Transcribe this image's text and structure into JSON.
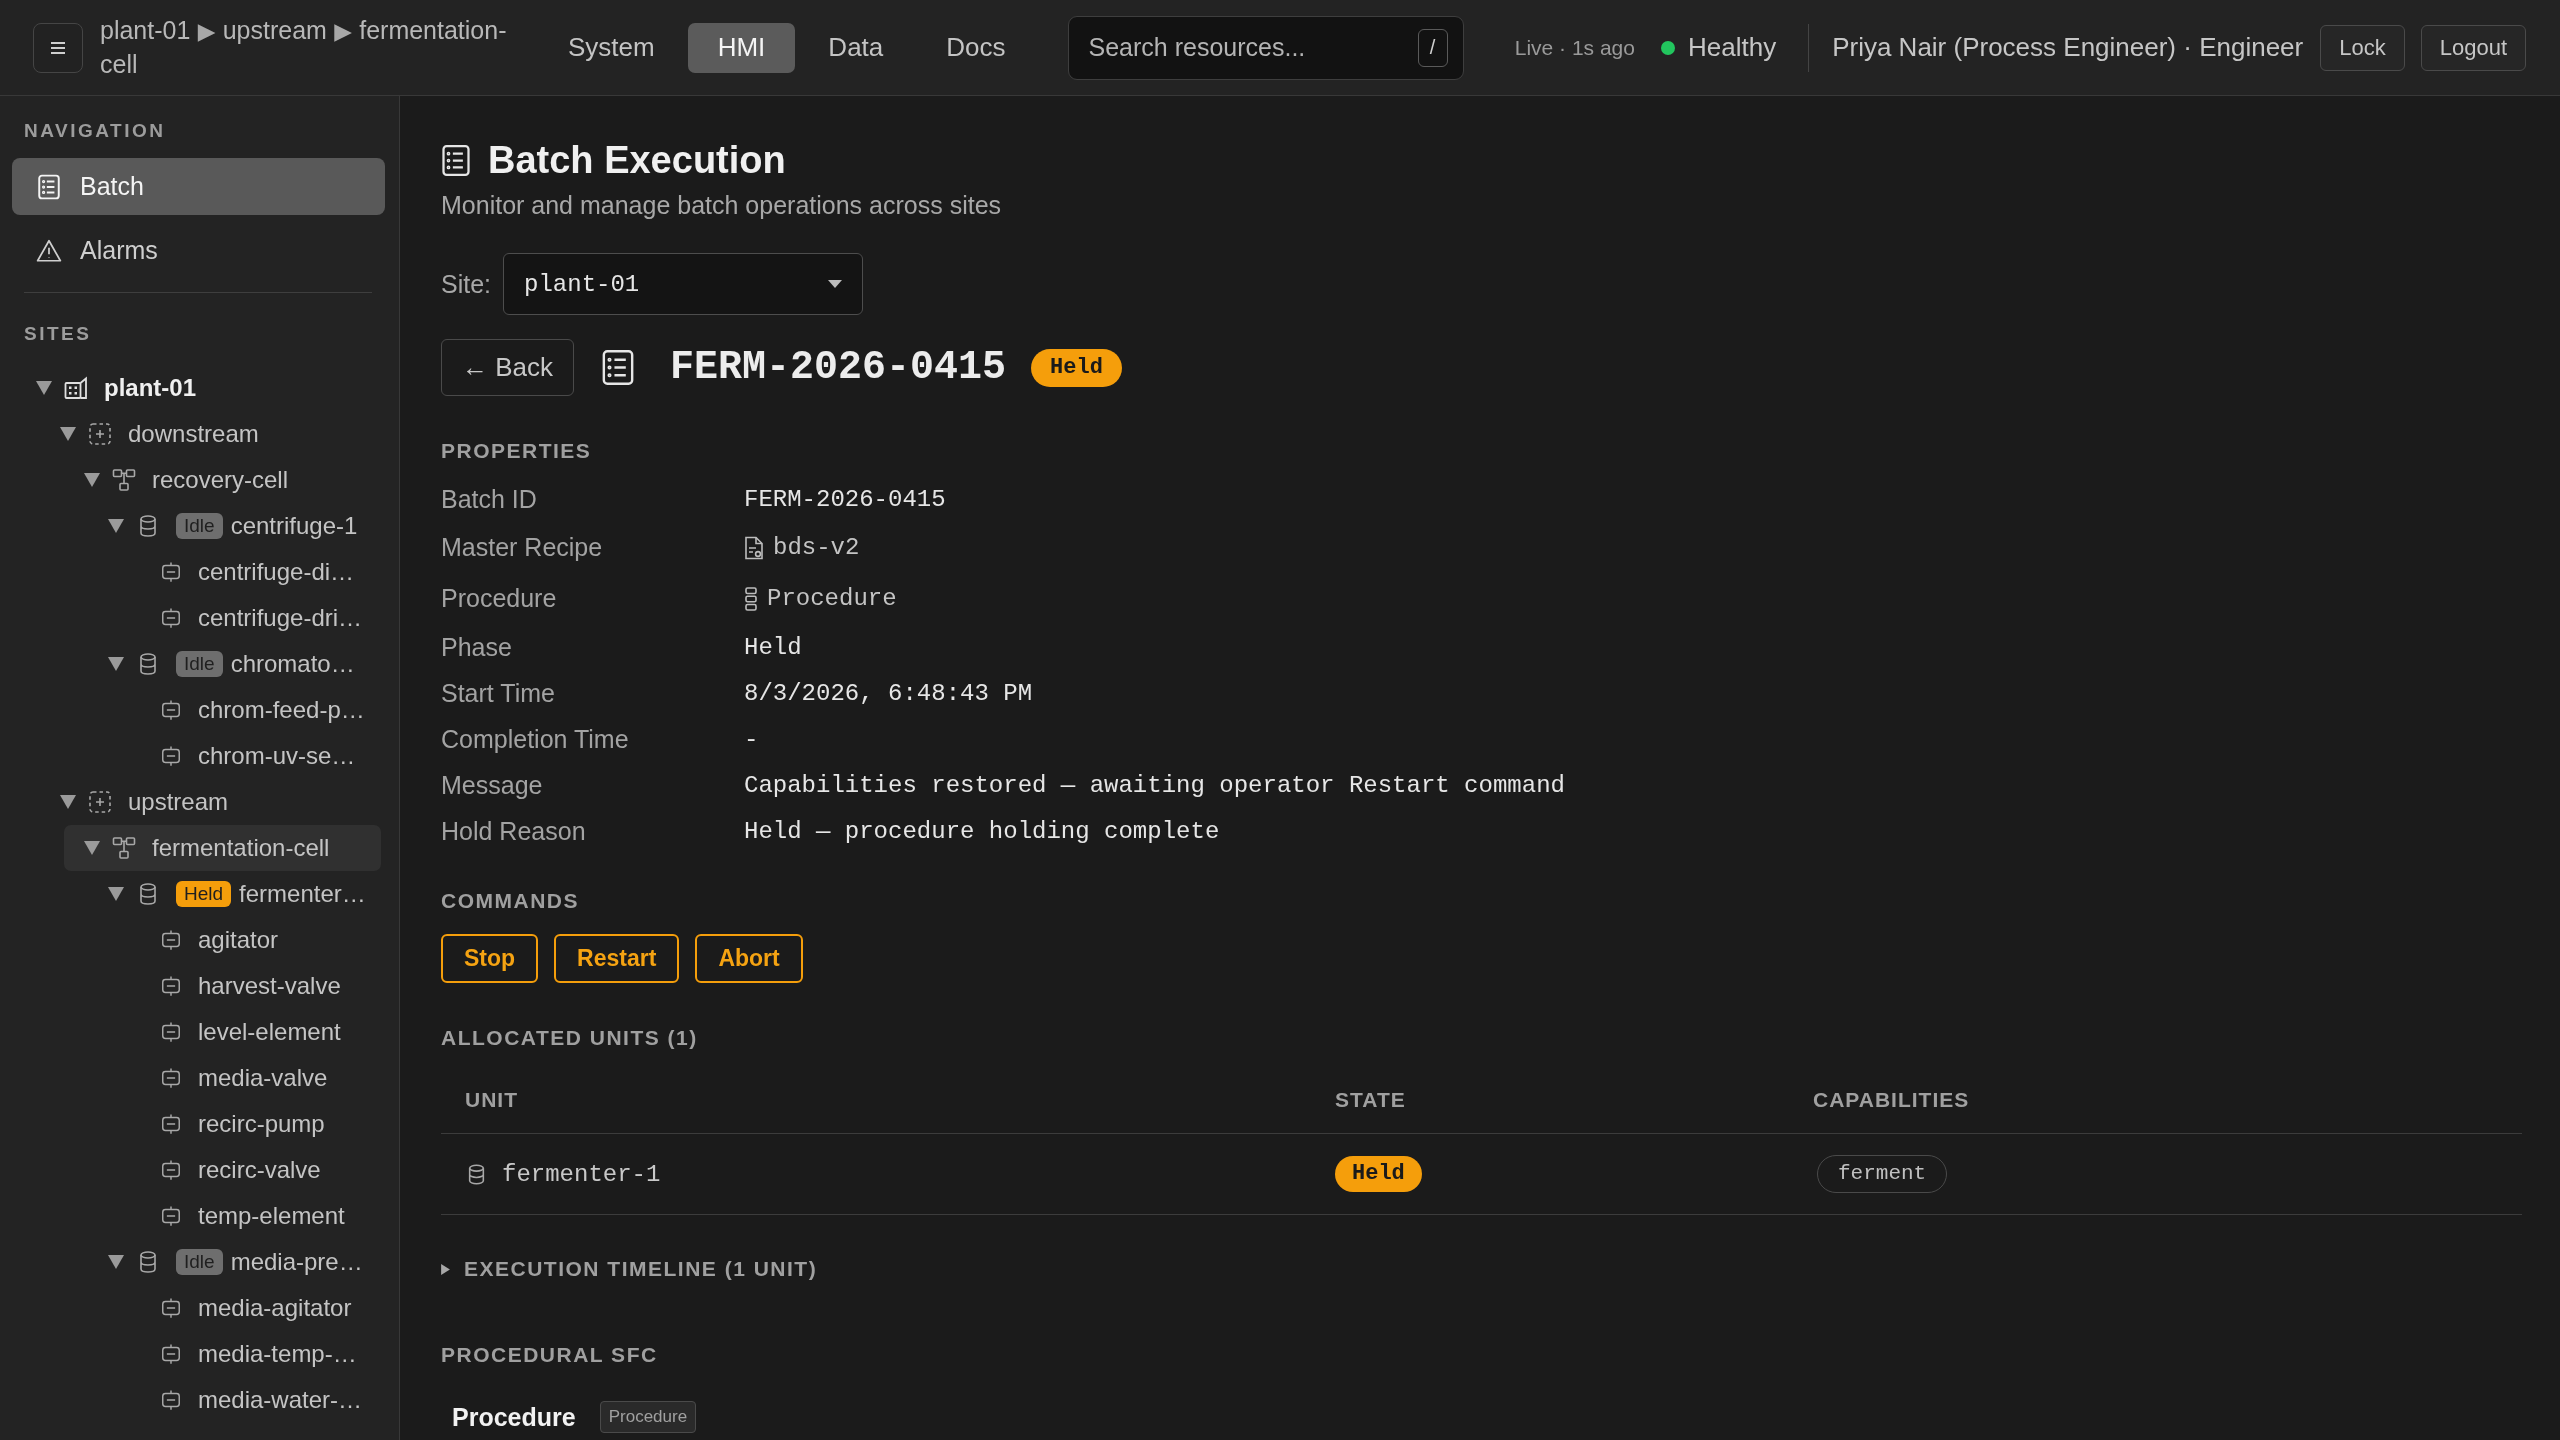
{
  "topbar": {
    "breadcrumb": {
      "items": [
        "plant-01",
        "upstream",
        "fermentation-cell"
      ],
      "separator": "▶"
    },
    "tabs": [
      {
        "label": "System",
        "selected": false
      },
      {
        "label": "HMI",
        "selected": true
      },
      {
        "label": "Data",
        "selected": false
      },
      {
        "label": "Docs",
        "selected": false
      }
    ],
    "search": {
      "placeholder": "Search resources...",
      "shortcut": "/"
    },
    "live": "Live · 1s ago",
    "health": {
      "label": "Healthy",
      "color": "#22c55e"
    },
    "user": "Priya Nair (Process Engineer) · Engineer",
    "buttons": [
      "Lock",
      "Logout"
    ]
  },
  "sidebar": {
    "nav_heading": "NAVIGATION",
    "nav": [
      {
        "label": "Batch",
        "kind": "batch",
        "selected": true
      },
      {
        "label": "Alarms",
        "kind": "alarms",
        "selected": false
      }
    ],
    "sites_heading": "SITES",
    "tree": [
      {
        "label": "plant-01",
        "kind": "site",
        "expanded": true,
        "selected": false,
        "children": [
          {
            "label": "downstream",
            "kind": "area",
            "expanded": true,
            "selected": false,
            "children": [
              {
                "label": "recovery-cell",
                "kind": "cell",
                "expanded": true,
                "selected": false,
                "children": [
                  {
                    "label": "centrifuge-1",
                    "kind": "unit",
                    "badge": {
                      "label": "Idle",
                      "color": "#6e6e6e"
                    },
                    "expanded": true,
                    "selected": false,
                    "children": [
                      {
                        "label": "centrifuge-di…",
                        "kind": "module",
                        "selected": false
                      },
                      {
                        "label": "centrifuge-dri…",
                        "kind": "module",
                        "selected": false
                      }
                    ]
                  },
                  {
                    "label": "chromato…",
                    "kind": "unit",
                    "badge": {
                      "label": "Idle",
                      "color": "#6e6e6e"
                    },
                    "expanded": true,
                    "selected": false,
                    "children": [
                      {
                        "label": "chrom-feed-p…",
                        "kind": "module",
                        "selected": false
                      },
                      {
                        "label": "chrom-uv-se…",
                        "kind": "module",
                        "selected": false
                      }
                    ]
                  }
                ]
              }
            ]
          },
          {
            "label": "upstream",
            "kind": "area",
            "expanded": true,
            "selected": false,
            "children": [
              {
                "label": "fermentation-cell",
                "kind": "cell",
                "expanded": true,
                "selected": true,
                "children": [
                  {
                    "label": "fermenter…",
                    "kind": "unit",
                    "badge": {
                      "label": "Held",
                      "color": "#f59e0b"
                    },
                    "expanded": true,
                    "selected": false,
                    "children": [
                      {
                        "label": "agitator",
                        "kind": "module",
                        "selected": false
                      },
                      {
                        "label": "harvest-valve",
                        "kind": "module",
                        "selected": false
                      },
                      {
                        "label": "level-element",
                        "kind": "module",
                        "selected": false
                      },
                      {
                        "label": "media-valve",
                        "kind": "module",
                        "selected": false
                      },
                      {
                        "label": "recirc-pump",
                        "kind": "module",
                        "selected": false
                      },
                      {
                        "label": "recirc-valve",
                        "kind": "module",
                        "selected": false
                      },
                      {
                        "label": "temp-element",
                        "kind": "module",
                        "selected": false
                      }
                    ]
                  },
                  {
                    "label": "media-pre…",
                    "kind": "unit",
                    "badge": {
                      "label": "Idle",
                      "color": "#6e6e6e"
                    },
                    "expanded": true,
                    "selected": false,
                    "children": [
                      {
                        "label": "media-agitator",
                        "kind": "module",
                        "selected": false
                      },
                      {
                        "label": "media-temp-…",
                        "kind": "module",
                        "selected": false
                      },
                      {
                        "label": "media-water-…",
                        "kind": "module",
                        "selected": false
                      }
                    ]
                  }
                ]
              }
            ]
          }
        ]
      }
    ]
  },
  "page": {
    "title": "Batch Execution",
    "subtitle": "Monitor and manage batch operations across sites",
    "site_label": "Site:",
    "site_value": "plant-01"
  },
  "batch": {
    "back": "← Back",
    "title": "FERM-2026-0415",
    "status": {
      "label": "Held",
      "color": "#f59e0b"
    }
  },
  "properties": {
    "heading": "PROPERTIES",
    "rows": [
      {
        "label": "Batch ID",
        "value": "FERM-2026-0415",
        "kind": "text"
      },
      {
        "label": "Master Recipe",
        "value": "bds-v2",
        "kind": "recipe"
      },
      {
        "label": "Procedure",
        "value": "Procedure",
        "kind": "procedure"
      },
      {
        "label": "Phase",
        "value": "Held",
        "kind": "text"
      },
      {
        "label": "Start Time",
        "value": "8/3/2026, 6:48:43 PM",
        "kind": "text"
      },
      {
        "label": "Completion Time",
        "value": "-",
        "kind": "text"
      },
      {
        "label": "Message",
        "value": "Capabilities restored — awaiting operator Restart command",
        "kind": "text"
      },
      {
        "label": "Hold Reason",
        "value": "Held — procedure holding complete",
        "kind": "text"
      }
    ]
  },
  "commands": {
    "heading": "COMMANDS",
    "buttons": [
      "Stop",
      "Restart",
      "Abort"
    ]
  },
  "units": {
    "heading": "ALLOCATED UNITS (1)",
    "columns": [
      "UNIT",
      "STATE",
      "CAPABILITIES"
    ],
    "rows": [
      {
        "unit": "fermenter-1",
        "state": {
          "label": "Held",
          "color": "#f59e0b"
        },
        "capabilities": [
          "ferment"
        ]
      }
    ]
  },
  "timeline": {
    "label": "EXECUTION TIMELINE (1 UNIT)",
    "expanded": false
  },
  "sfc": {
    "heading": "PROCEDURAL SFC",
    "name": "Procedure",
    "tag": "Procedure"
  }
}
